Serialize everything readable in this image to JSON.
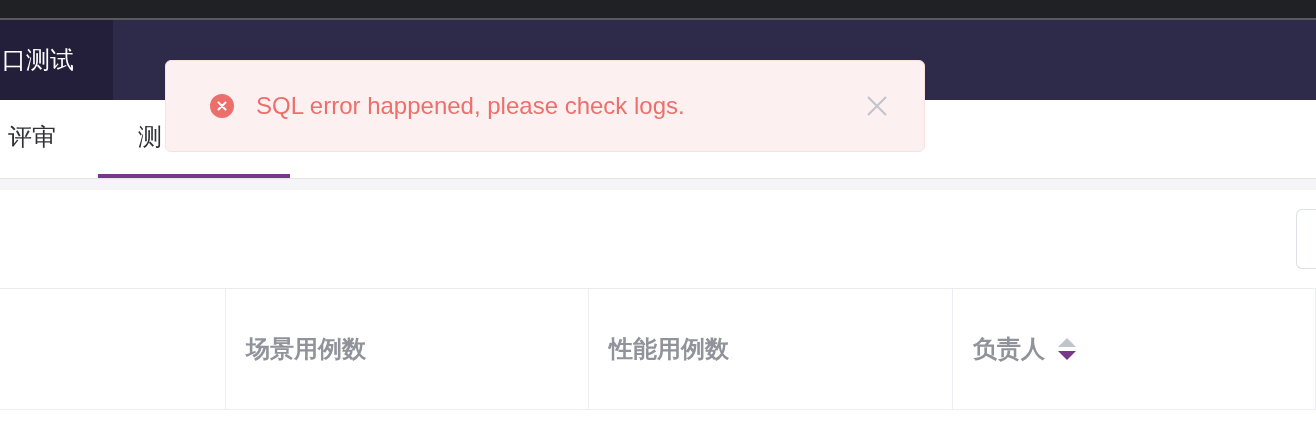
{
  "top_nav": {
    "items": [
      {
        "label": "口测试",
        "selected": true
      }
    ]
  },
  "sub_tabs": [
    {
      "label": "评审",
      "selected": false
    },
    {
      "label": "测",
      "selected": true
    }
  ],
  "table": {
    "columns": [
      {
        "label": "场景用例数"
      },
      {
        "label": "性能用例数"
      },
      {
        "label": "负责人",
        "sort_descending": true
      }
    ]
  },
  "toast": {
    "kind": "error",
    "message": "SQL error happened, please check logs."
  }
}
